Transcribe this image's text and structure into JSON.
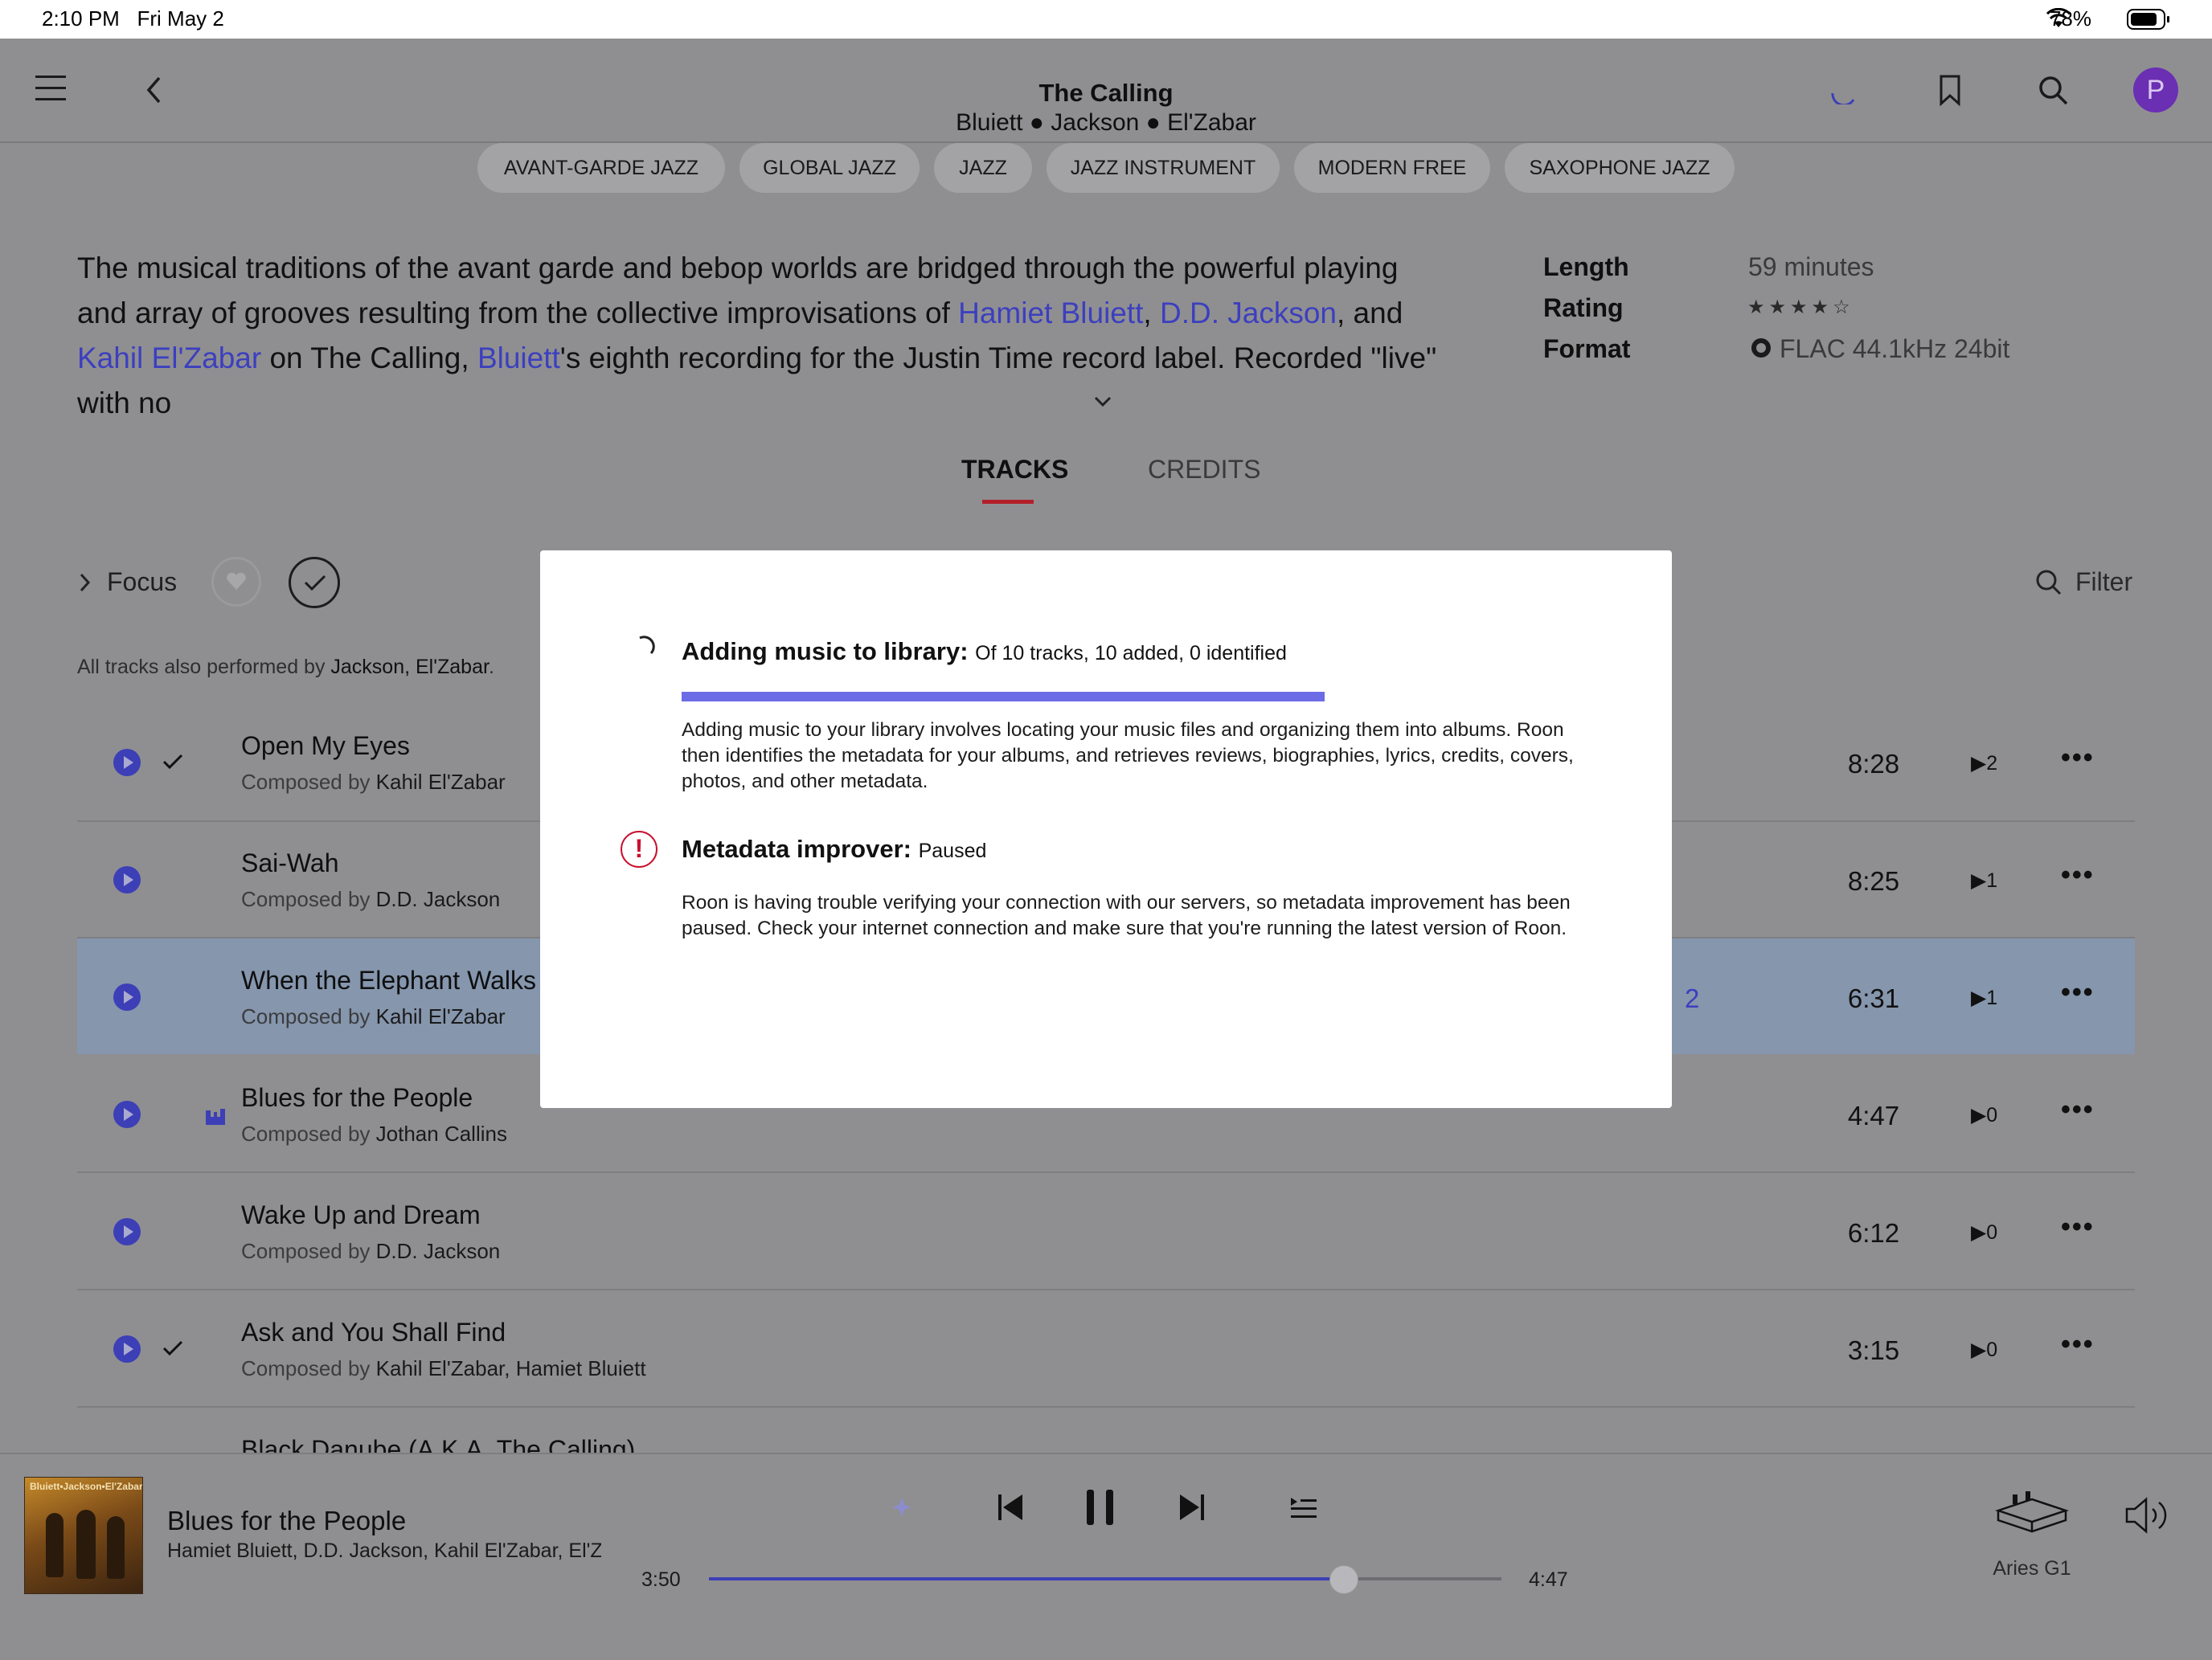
{
  "status_bar": {
    "time": "2:10 PM",
    "date": "Fri May 2",
    "battery": "78%"
  },
  "header": {
    "title": "The Calling",
    "artists": "Bluiett ● Jackson ● El'Zabar"
  },
  "genres": [
    "AVANT-GARDE JAZZ",
    "GLOBAL JAZZ",
    "JAZZ",
    "JAZZ INSTRUMENT",
    "MODERN FREE",
    "SAXOPHONE JAZZ"
  ],
  "description": {
    "p1": "The musical traditions of the avant garde and bebop worlds are bridged through the powerful playing and array of grooves resulting from the collective improvisations of ",
    "link1": "Hamiet Bluiett",
    "sep1": ", ",
    "link2": "D.D. Jackson",
    "sep2": ", and ",
    "link3": "Kahil El'Zabar",
    "p2": " on The Calling, ",
    "link4": "Bluiett",
    "p3": "'s eighth recording for the Justin Time record label. Recorded \"live\" with no"
  },
  "meta": {
    "length_label": "Length",
    "length_value": "59 minutes",
    "rating_label": "Rating",
    "rating_stars": 4,
    "rating_max": 5,
    "format_label": "Format",
    "format_value": "FLAC 44.1kHz 24bit"
  },
  "tabs": {
    "tracks": "TRACKS",
    "credits": "CREDITS"
  },
  "toolbar": {
    "focus": "Focus",
    "filter": "Filter"
  },
  "performed_by": {
    "prefix": "All tracks also performed by ",
    "names": "Jackson, El'Zabar",
    "suffix": "."
  },
  "composed_prefix": "Composed by ",
  "tracks": [
    {
      "title": "Open My Eyes",
      "composer": "Kahil El'Zabar",
      "duration": "8:28",
      "plays": "2",
      "checked": true
    },
    {
      "title": "Sai-Wah",
      "composer": "D.D. Jackson",
      "duration": "8:25",
      "plays": "1",
      "checked": false
    },
    {
      "title": "When the Elephant Walks",
      "composer": "Kahil El'Zabar",
      "duration": "6:31",
      "plays": "1",
      "checked": false,
      "highlighted": true,
      "extra": "2"
    },
    {
      "title": "Blues for the People",
      "composer": "Jothan Callins",
      "duration": "4:47",
      "plays": "0",
      "checked": false,
      "now_playing": true
    },
    {
      "title": "Wake Up and Dream",
      "composer": "D.D. Jackson",
      "duration": "6:12",
      "plays": "0",
      "checked": false
    },
    {
      "title": "Ask and You Shall Find",
      "composer": "Kahil El'Zabar, Hamiet Bluiett",
      "duration": "3:15",
      "plays": "0",
      "checked": true
    },
    {
      "title": "Black Danube (A.K.A. The Calling)"
    }
  ],
  "modal": {
    "adding_title": "Adding music to library:",
    "adding_status": "Of 10 tracks, 10 added, 0 identified",
    "adding_progress": 1.0,
    "adding_desc": "Adding music to your library involves locating your music files and organizing them into albums. Roon then identifies the metadata for your albums, and retrieves reviews, biographies, lyrics, credits, covers, photos, and other metadata.",
    "improver_title": "Metadata improver:",
    "improver_status": "Paused",
    "improver_desc": "Roon is having trouble verifying your connection with our servers, so metadata improvement has been paused. Check your internet connection and make sure that you're running the latest version of Roon."
  },
  "player": {
    "album_art_text": "Bluiett•Jackson•El'Zabar",
    "track": "Blues for the People",
    "artists": "Hamiet Bluiett, D.D. Jackson, Kahil El'Zabar, El'Z",
    "elapsed": "3:50",
    "total": "4:47",
    "progress": 0.8,
    "zone": "Aries G1"
  },
  "colors": {
    "accent": "#3c3fbf",
    "modal_progress": "#6b6ce6",
    "alert": "#c8102e",
    "tab_underline": "#b3202a"
  },
  "avatar": {
    "letter": "P"
  }
}
